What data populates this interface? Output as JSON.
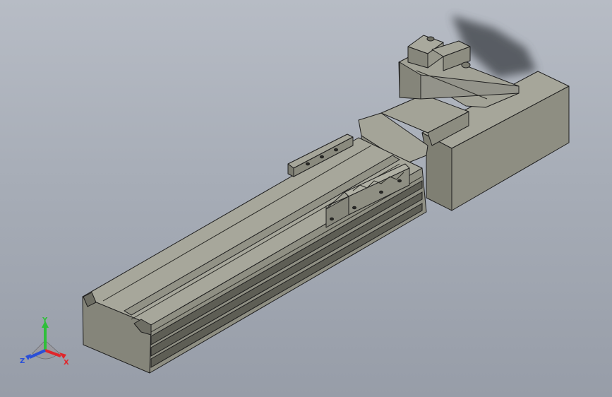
{
  "viewport": {
    "model_name": "linear-actuator-with-servo-motor"
  },
  "triad": {
    "x_label": "X",
    "y_label": "Y",
    "z_label": "Z",
    "x_color": "#e0262b",
    "y_color": "#2fbf3a",
    "z_color": "#2a4fd8"
  },
  "colors": {
    "body_top": "#a6a69a",
    "body_side": "#8b8b7e",
    "body_front": "#7a7a6e",
    "edge": "#1e1e1e",
    "background_top": "#b7bcc5",
    "background_bottom": "#979da8"
  }
}
